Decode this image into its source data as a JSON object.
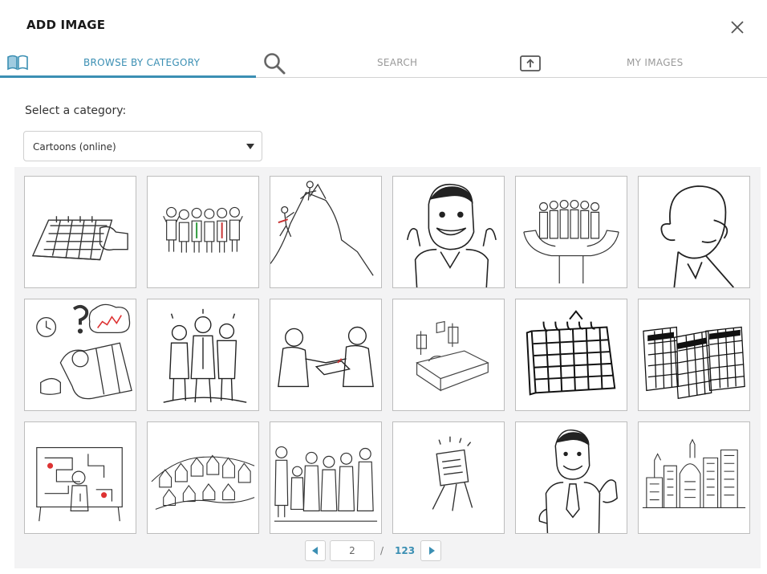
{
  "dialog": {
    "title": "ADD IMAGE"
  },
  "tabs": [
    {
      "label": "BROWSE BY CATEGORY",
      "icon": "book-icon",
      "active": true
    },
    {
      "label": "SEARCH",
      "icon": "search-icon",
      "active": false
    },
    {
      "label": "MY IMAGES",
      "icon": "upload-icon",
      "active": false
    }
  ],
  "category": {
    "label": "Select a category:",
    "selected": "Cartoons (online)"
  },
  "gallery": {
    "thumbnails": [
      "calendar-hand",
      "diverse-team",
      "mountain-climbers",
      "thumbs-up-man",
      "people-in-hands",
      "man-profile",
      "confused-businessman",
      "three-professionals",
      "handshake-meeting",
      "hospital-bed",
      "wall-calendar",
      "year-calendars",
      "maze-board",
      "crowded-cityscape",
      "family-group",
      "solar-sign",
      "businessman-thumbs-up",
      "city-skyline"
    ]
  },
  "pagination": {
    "current": "2",
    "separator": "/",
    "total": "123"
  },
  "colors": {
    "accent": "#3b8fb3",
    "border": "#d2d2d2",
    "gallery_bg": "#f3f3f4"
  }
}
